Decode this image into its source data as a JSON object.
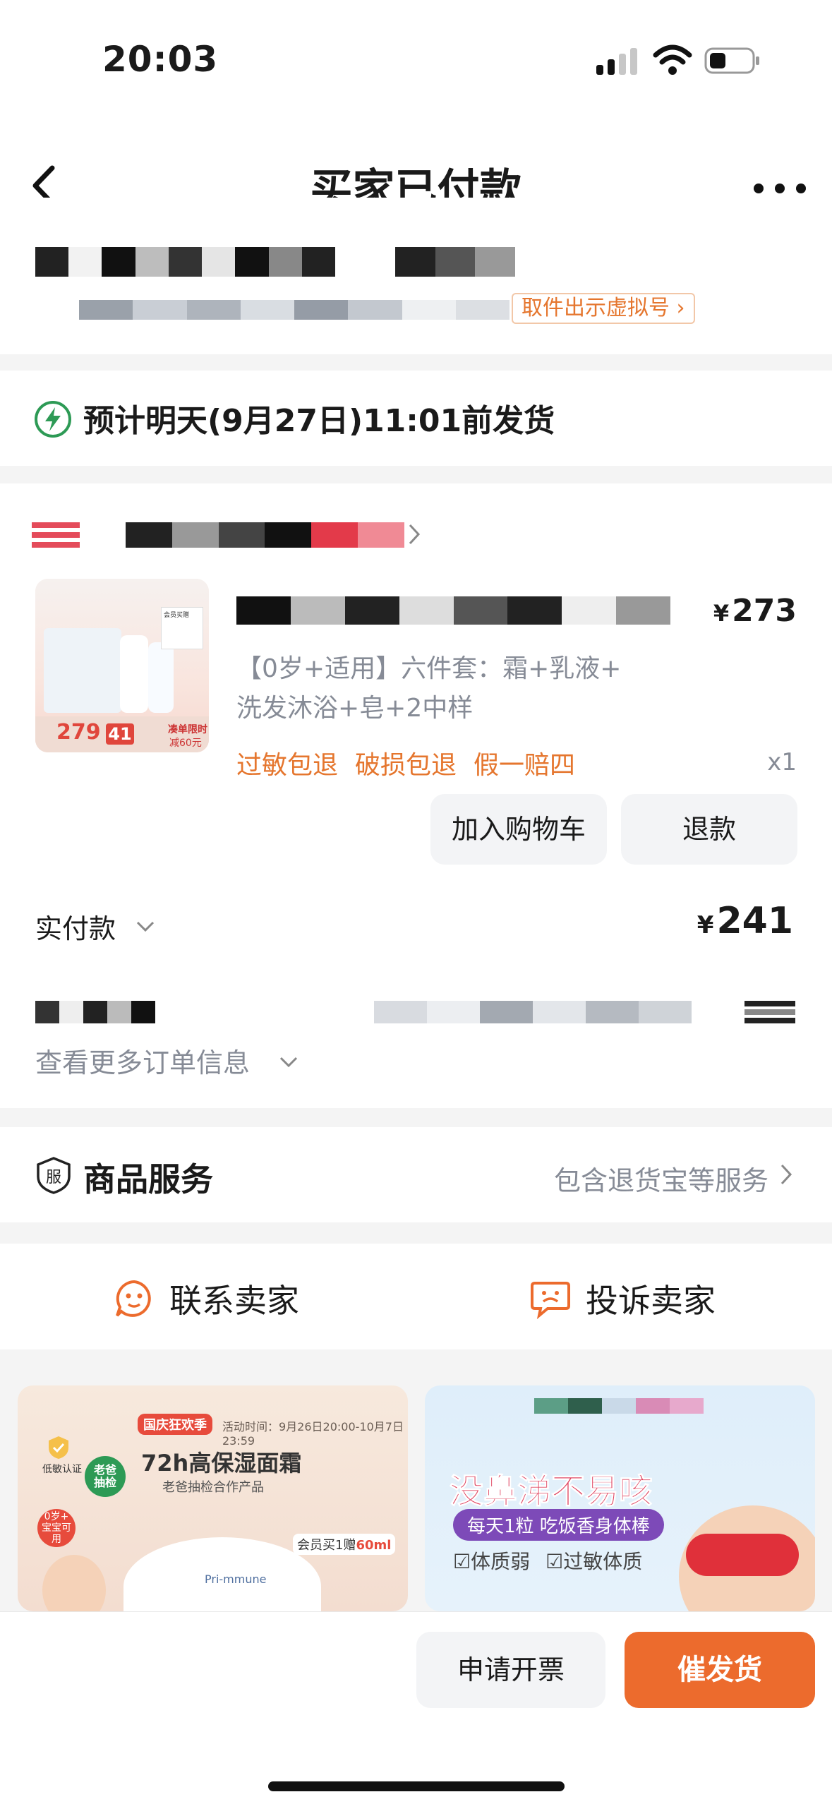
{
  "status_bar": {
    "time": "20:03"
  },
  "nav": {
    "title": "买家已付款"
  },
  "address": {
    "virtual_number_btn": "取件出示虚拟号 ›"
  },
  "shipping": {
    "text": "预计明天(9月27日)11:01前发货"
  },
  "product": {
    "price": "273",
    "currency": "¥",
    "spec_line1": "【0岁+适用】六件套：霜+乳液+",
    "spec_line2": "洗发沐浴+皂+2中样",
    "tags": [
      "过敏包退",
      "破损包退",
      "假一赔四"
    ],
    "quantity": "x1",
    "thumb_price": "279",
    "thumb_discount": "41",
    "thumb_note1": "凑单限时",
    "thumb_note2": "减60元",
    "thumb_vip": "会员买赠"
  },
  "actions": {
    "add_to_cart": "加入购物车",
    "refund": "退款"
  },
  "payment": {
    "label": "实付款",
    "amount": "241",
    "currency": "¥"
  },
  "more_info": {
    "label": "查看更多订单信息"
  },
  "service": {
    "icon_text": "服",
    "title": "商品服务",
    "desc": "包含退货宝等服务"
  },
  "contact": {
    "contact_seller": "联系卖家",
    "complain_seller": "投诉卖家"
  },
  "banner_left": {
    "promo": "国庆狂欢季",
    "date": "活动时间：9月26日20:00-10月7日23:59",
    "title": "72h高保湿面霜",
    "subtitle": "老爸抽检合作产品",
    "badge_certified": "低敏认证",
    "badge_check_l1": "老爸",
    "badge_check_l2": "抽检",
    "age_l1": "0岁+",
    "age_l2": "宝宝可用",
    "jar_text": "Pri-mmune",
    "gift_prefix": "会员买1赠",
    "gift_amount": "60ml"
  },
  "banner_right": {
    "title": "没鼻涕不易咳",
    "pill": "每天1粒 吃饭香身体棒",
    "check1": "体质弱",
    "check2": "过敏体质"
  },
  "bottom": {
    "invoice": "申请开票",
    "urge": "催发货"
  },
  "colors": {
    "accent": "#ec6b2d",
    "orange_text": "#e5762e",
    "grey_text": "#868b96",
    "ship_green": "#2d9a55"
  }
}
